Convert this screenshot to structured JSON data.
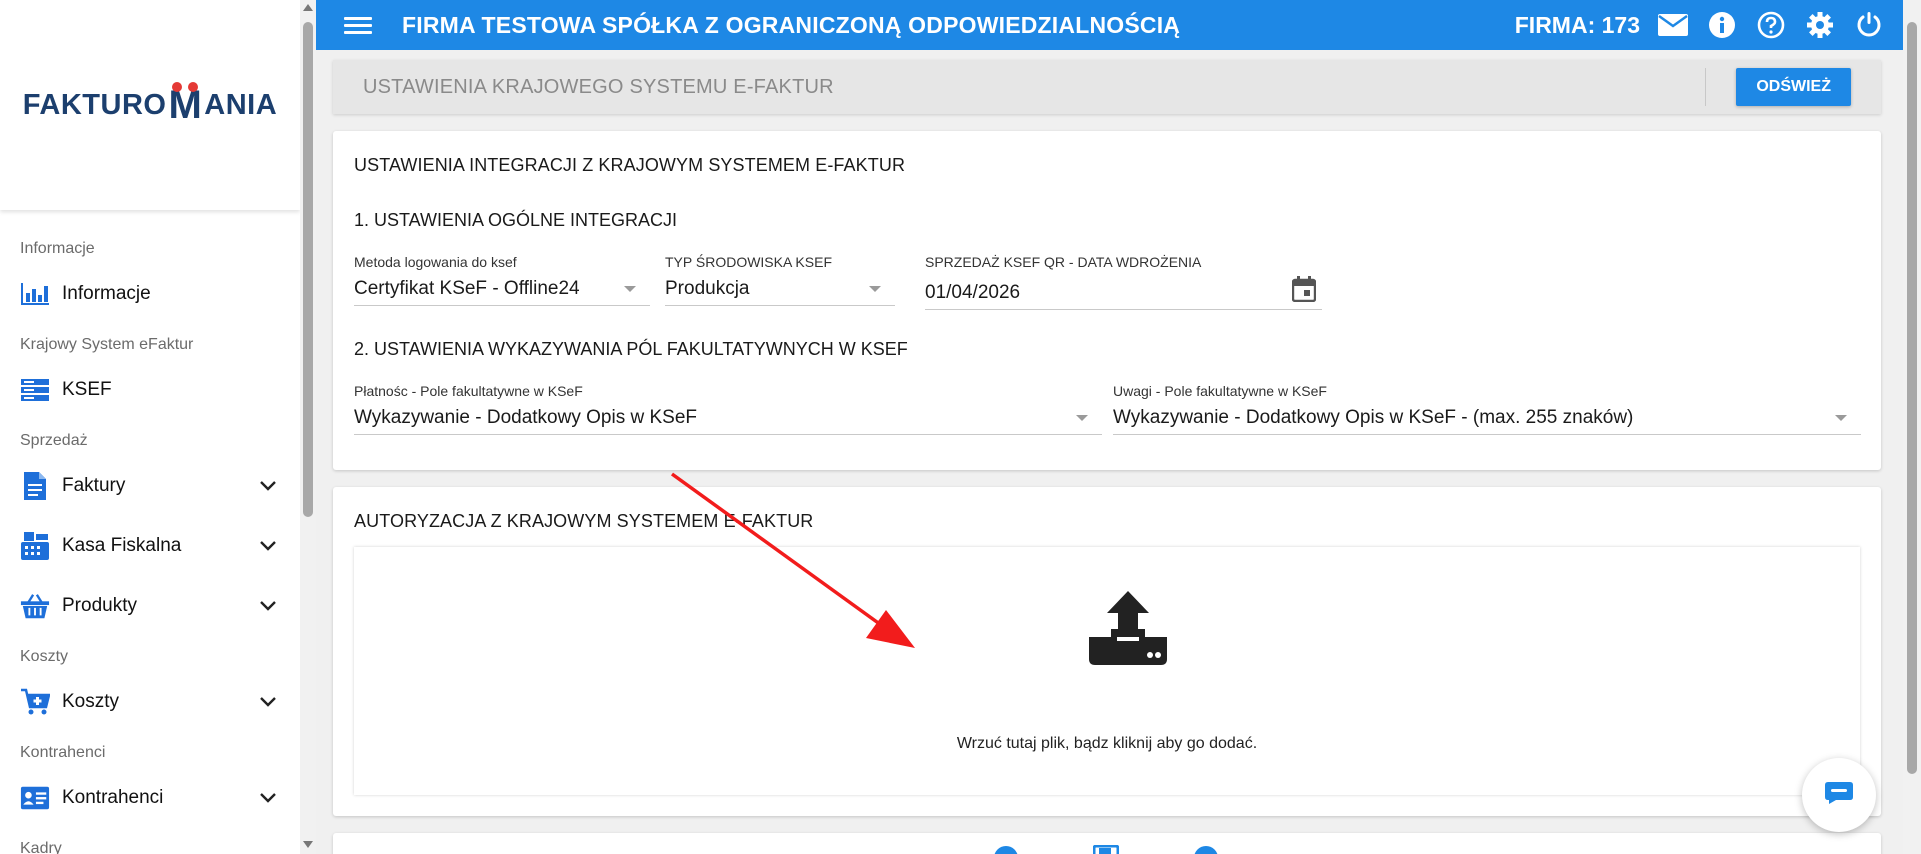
{
  "sidebar": {
    "logo_left": "FAKTURO",
    "logo_m": "M",
    "logo_right": "ANIA",
    "sections": [
      {
        "title": "Informacje",
        "item": "Informacje",
        "icon": "bar-chart-icon",
        "expandable": false
      },
      {
        "title": "Krajowy System eFaktur",
        "item": "KSEF",
        "icon": "server-icon",
        "expandable": false
      },
      {
        "title": "Sprzedaż",
        "item": "Faktury",
        "icon": "document-icon",
        "expandable": true
      },
      {
        "title": "",
        "item": "Kasa Fiskalna",
        "icon": "cash-register-icon",
        "expandable": true
      },
      {
        "title": "",
        "item": "Produkty",
        "icon": "basket-icon",
        "expandable": true
      },
      {
        "title": "Koszty",
        "item": "Koszty",
        "icon": "cart-icon",
        "expandable": true
      },
      {
        "title": "Kontrahenci",
        "item": "Kontrahenci",
        "icon": "contact-card-icon",
        "expandable": true
      },
      {
        "title": "Kadry",
        "item": "",
        "icon": "",
        "expandable": false
      }
    ]
  },
  "topbar": {
    "title": "FIRMA TESTOWA SPÓŁKA Z OGRANICZONĄ ODPOWIEDZIALNOŚCIĄ",
    "firma": "FIRMA: 173",
    "color": "#1e88e5"
  },
  "header": {
    "title": "USTAWIENIA KRAJOWEGO SYSTEMU E-FAKTUR",
    "refresh_label": "ODŚWIEŻ"
  },
  "integration": {
    "title": "USTAWIENIA INTEGRACJI Z KRAJOWYM SYSTEMEM E-FAKTUR",
    "section1": "1. USTAWIENIA OGÓLNE INTEGRACJI",
    "login_method": {
      "label": "Metoda logowania do ksef",
      "value": "Certyfikat KSeF - Offline24"
    },
    "env_type": {
      "label": "TYP ŚRODOWISKA KSEF",
      "value": "Produkcja"
    },
    "qr_date": {
      "label": "SPRZEDAŻ KSEF QR - DATA WDROŻENIA",
      "value": "01/04/2026"
    },
    "section2": "2. USTAWIENIA WYKAZYWANIA PÓL FAKULTATYWNYCH W KSEF",
    "payment": {
      "label": "Płatnośc - Pole fakultatywne w KSeF",
      "value": "Wykazywanie - Dodatkowy Opis w KSeF"
    },
    "remarks": {
      "label": "Uwagi - Pole fakultatywne w KSeF",
      "value": "Wykazywanie - Dodatkowy Opis w KSeF - (max. 255 znaków)"
    }
  },
  "authorization": {
    "title": "AUTORYZACJA Z KRAJOWYM SYSTEMEM E-FAKTUR",
    "dropzone_text": "Wrzuć tutaj plik, bądz kliknij aby go dodać.",
    "arrow_color": "#f21c1c"
  }
}
